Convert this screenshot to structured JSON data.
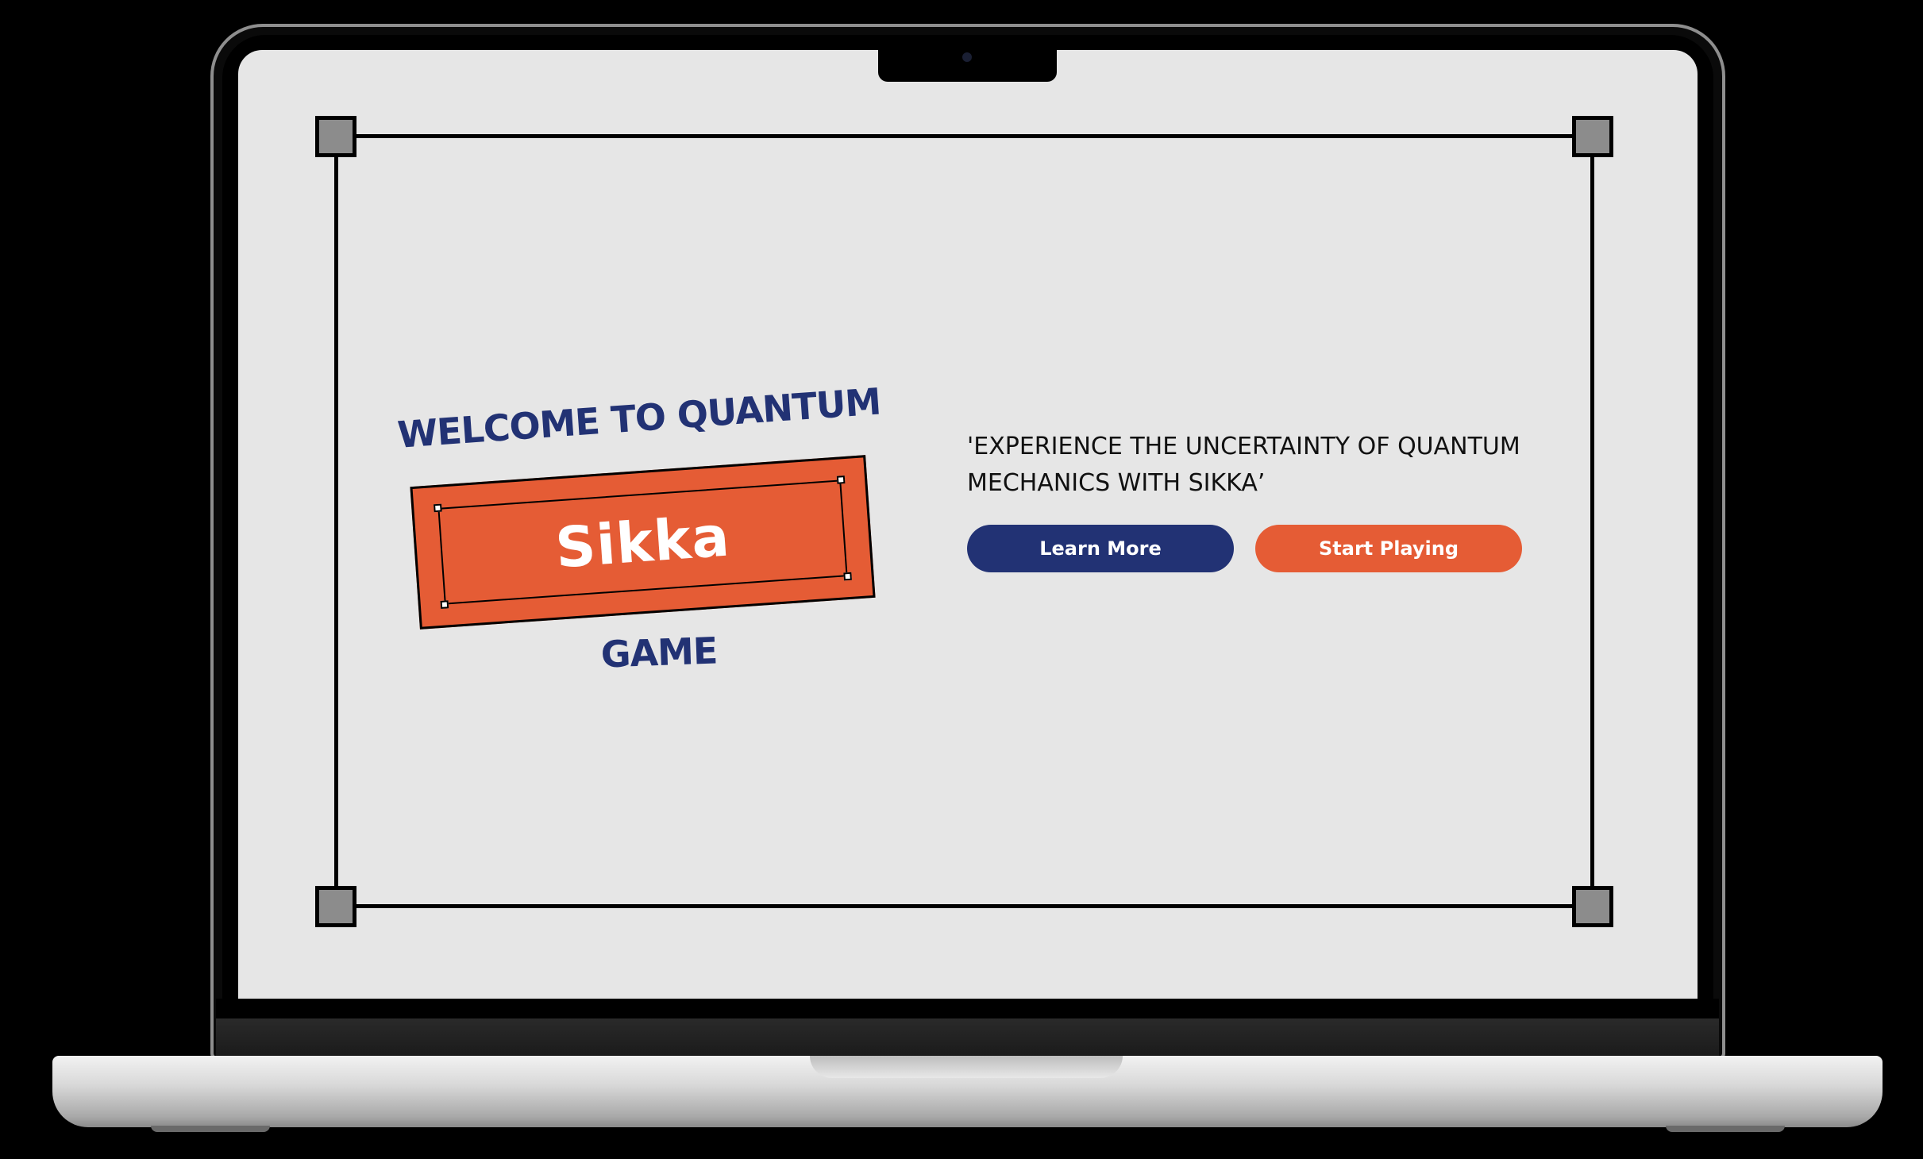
{
  "hero": {
    "title_top": "WELCOME TO QUANTUM",
    "title_tag": "Sikka",
    "title_bottom": "GAME",
    "tagline": "'EXPERIENCE THE UNCERTAINTY OF QUANTUM MECHANICS WITH SIKKA’"
  },
  "actions": {
    "learn_more_label": "Learn More",
    "start_playing_label": "Start Playing"
  },
  "colors": {
    "navy": "#223274",
    "orange": "#e55c35",
    "screen_bg": "#e6e6e6"
  }
}
